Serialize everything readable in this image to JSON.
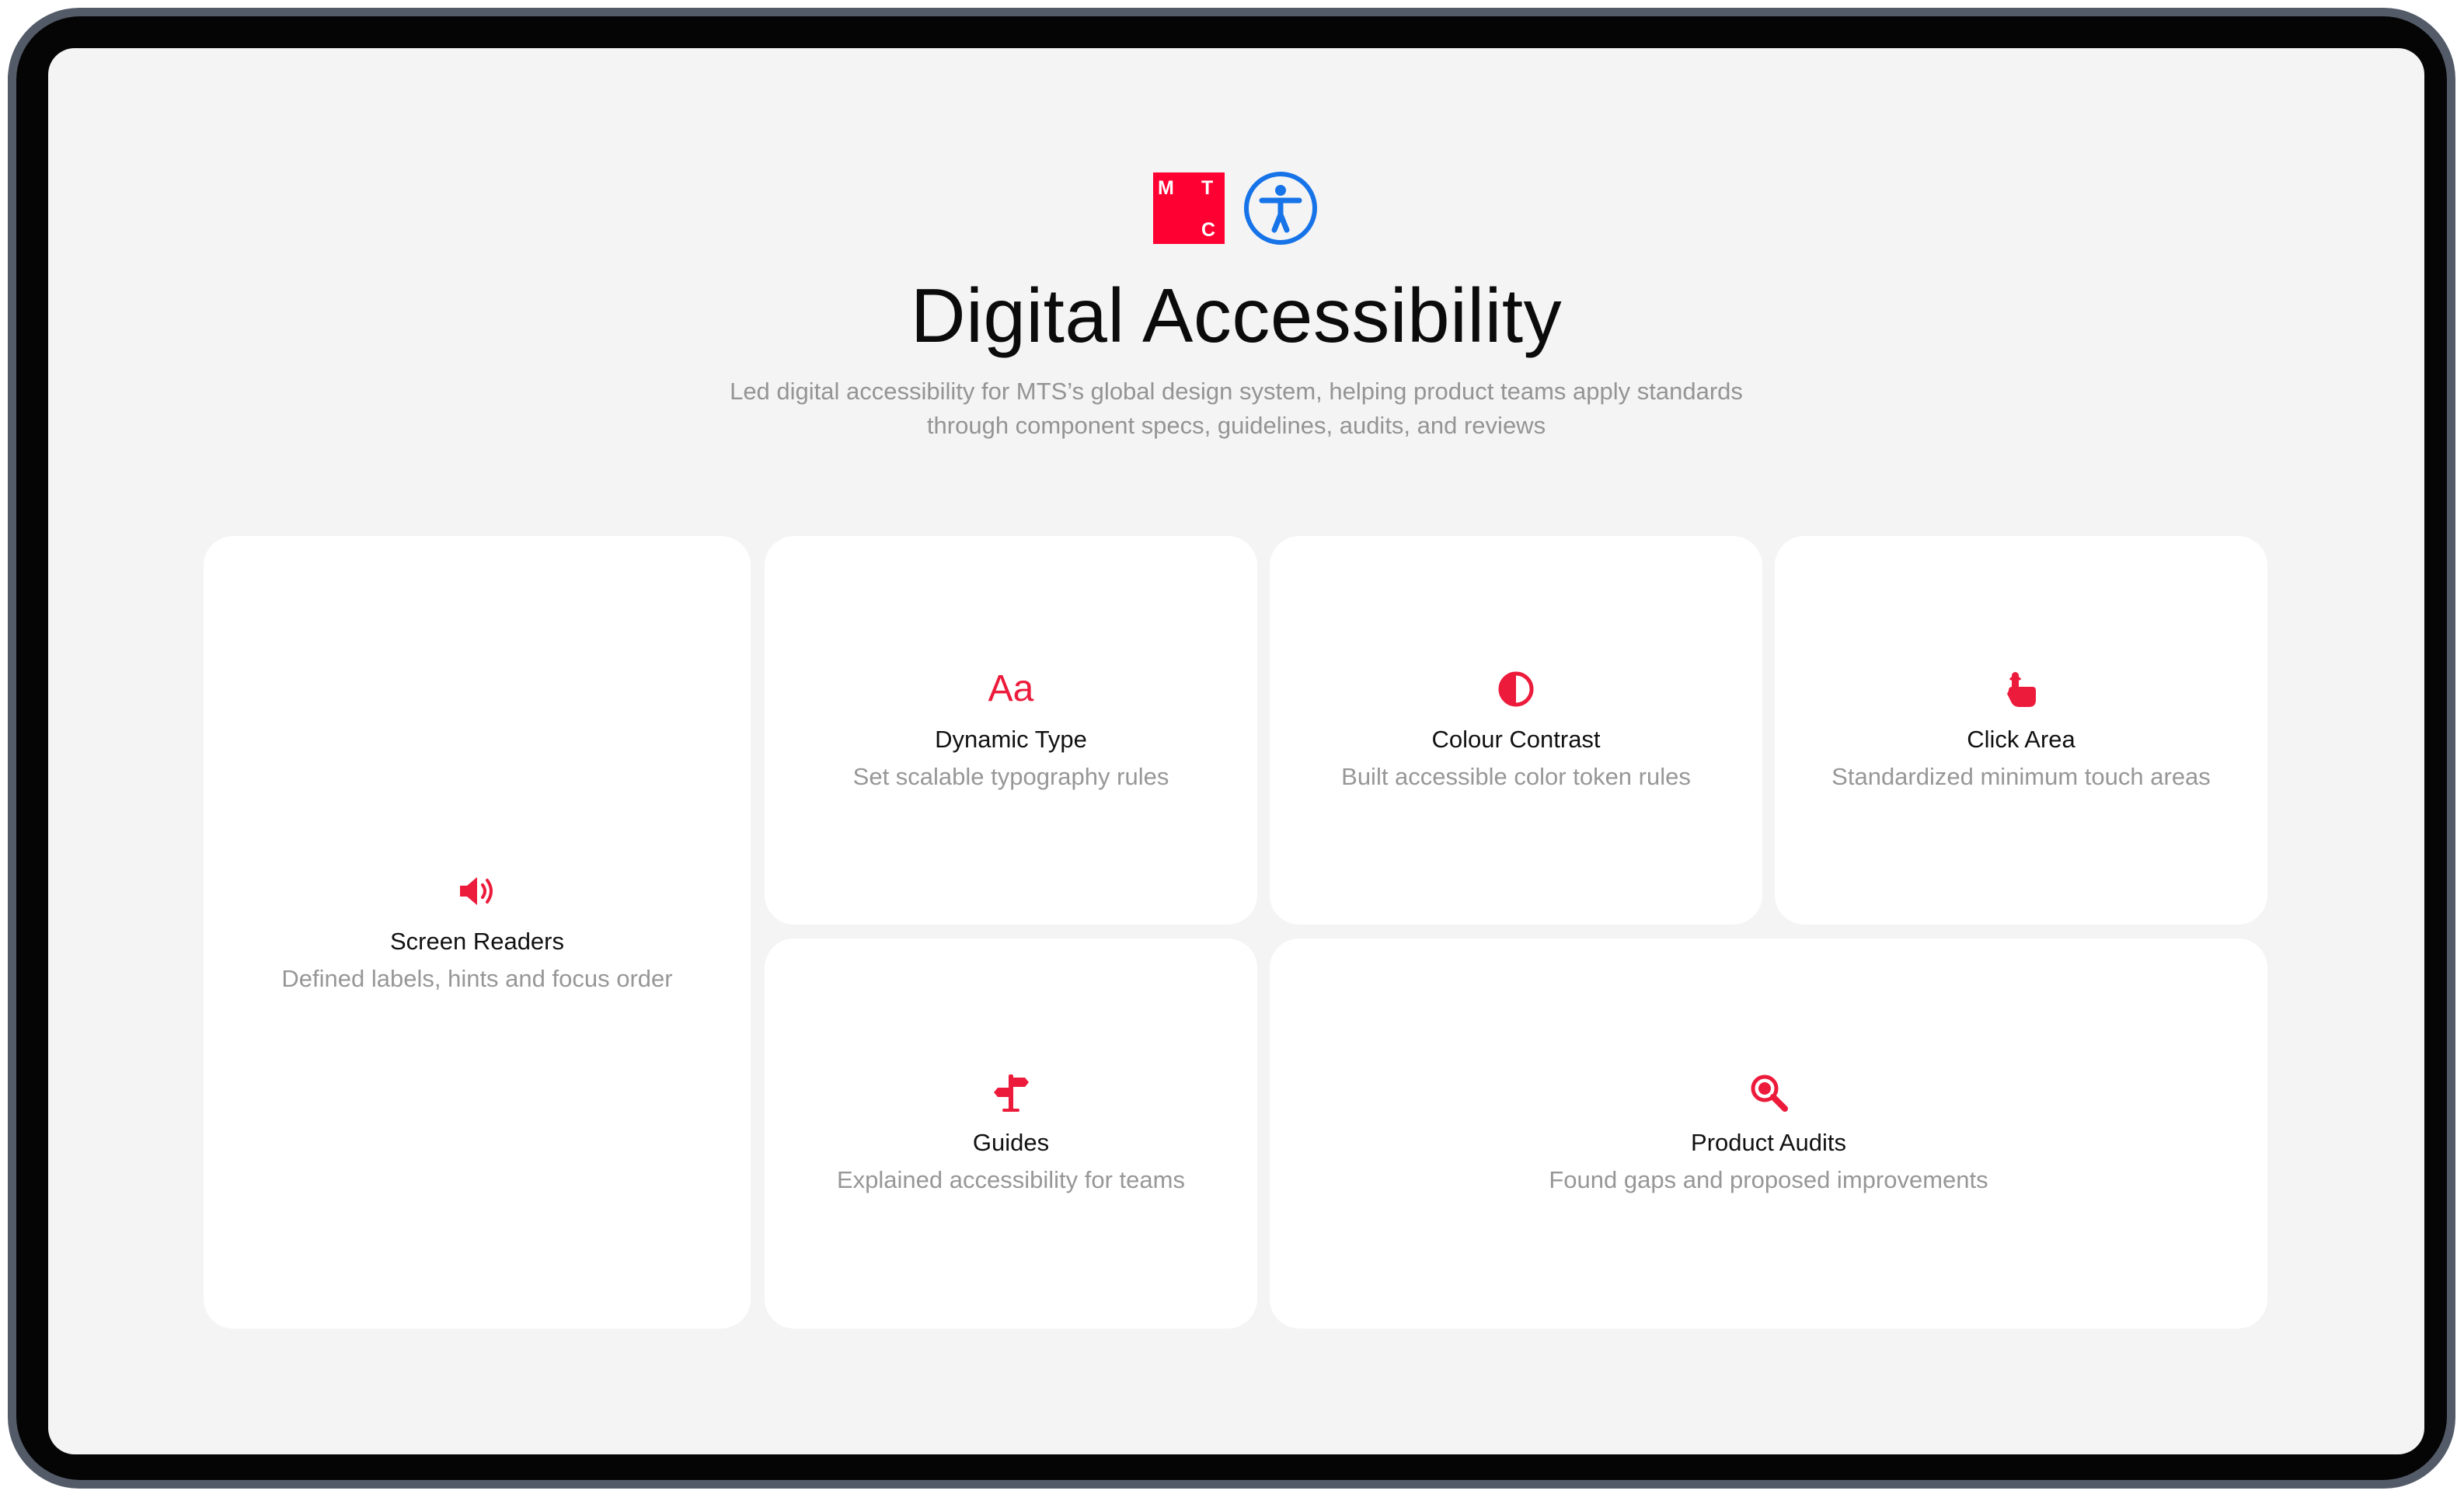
{
  "header": {
    "brand_logo_letters": [
      "M",
      "T",
      "C"
    ],
    "title": "Digital Accessibility",
    "subtitle": "Led digital accessibility for MTS’s global design system, helping product teams apply standards through component specs, guidelines, audits, and reviews"
  },
  "cards": [
    {
      "id": "screen-readers",
      "icon": "speaker-icon",
      "title": "Screen Readers",
      "desc": "Defined labels, hints and focus order"
    },
    {
      "id": "dynamic-type",
      "icon": "text-size-icon",
      "icon_text": "Aa",
      "title": "Dynamic Type",
      "desc": "Set scalable typography rules"
    },
    {
      "id": "colour-contrast",
      "icon": "contrast-icon",
      "title": "Colour Contrast",
      "desc": "Built accessible color token rules"
    },
    {
      "id": "click-area",
      "icon": "tap-hand-icon",
      "title": "Click Area",
      "desc": "Standardized minimum touch areas"
    },
    {
      "id": "guides",
      "icon": "signpost-icon",
      "title": "Guides",
      "desc": "Explained accessibility for teams"
    },
    {
      "id": "product-audits",
      "icon": "magnifier-icon",
      "title": "Product Audits",
      "desc": "Found gaps and proposed improvements"
    }
  ],
  "colors": {
    "accent": "#ED1B3B",
    "brand_red": "#FF0032",
    "accessibility_blue": "#1673E8",
    "screen_bg": "#F4F4F4",
    "card_bg": "#FFFFFF",
    "muted_text": "#979797"
  }
}
